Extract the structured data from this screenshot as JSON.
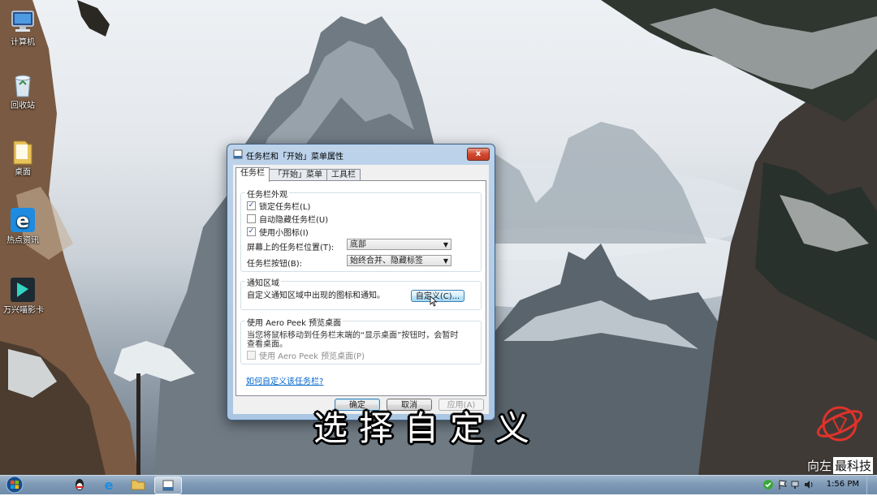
{
  "desktop": {
    "icons": [
      {
        "label": "计算机",
        "icon": "computer-icon"
      },
      {
        "label": "回收站",
        "icon": "recycle-bin-icon"
      },
      {
        "label": "桌面",
        "icon": "folder-icon"
      },
      {
        "label": "热点资讯",
        "icon": "ie-news-icon"
      },
      {
        "label": "万兴喵影卡",
        "icon": "wondershare-filmora-icon"
      }
    ]
  },
  "dialog": {
    "title": "任务栏和「开始」菜单属性",
    "close_label": "x",
    "tabs": [
      {
        "label": "任务栏",
        "active": true
      },
      {
        "label": "「开始」菜单",
        "active": false
      },
      {
        "label": "工具栏",
        "active": false
      }
    ],
    "appearance": {
      "group_label": "任务栏外观",
      "lock_taskbar": {
        "label": "锁定任务栏(L)",
        "checked": true
      },
      "auto_hide": {
        "label": "自动隐藏任务栏(U)",
        "checked": false
      },
      "small_icons": {
        "label": "使用小图标(I)",
        "checked": true
      },
      "location_label": "屏幕上的任务栏位置(T):",
      "location_value": "底部",
      "buttons_label": "任务栏按钮(B):",
      "buttons_value": "始终合并、隐藏标签"
    },
    "notification": {
      "group_label": "通知区域",
      "description": "自定义通知区域中出现的图标和通知。",
      "customize_button": "自定义(C)..."
    },
    "aero_peek": {
      "group_label": "使用 Aero Peek 预览桌面",
      "description_line1": "当您将鼠标移动到任务栏末端的“显示桌面”按钮时，会暂时",
      "description_line2": "查看桌面。",
      "checkbox_label": "使用 Aero Peek 预览桌面(P)",
      "checked": false
    },
    "help_link": "如何自定义该任务栏?",
    "ok_button": "确定",
    "cancel_button": "取消",
    "apply_button": "应用(A)"
  },
  "subtitle": "选择自定义",
  "watermark": {
    "text_left": "向左",
    "text_right": "最科技"
  },
  "taskbar": {
    "clock": "1:56 PM",
    "pinned": [
      "qq-icon",
      "ie-icon",
      "explorer-icon",
      "taskbar-properties-icon"
    ]
  },
  "colors": {
    "dialog_frame": "#aac6e2",
    "link": "#0066cc",
    "taskbar": "#7f9ab6"
  }
}
